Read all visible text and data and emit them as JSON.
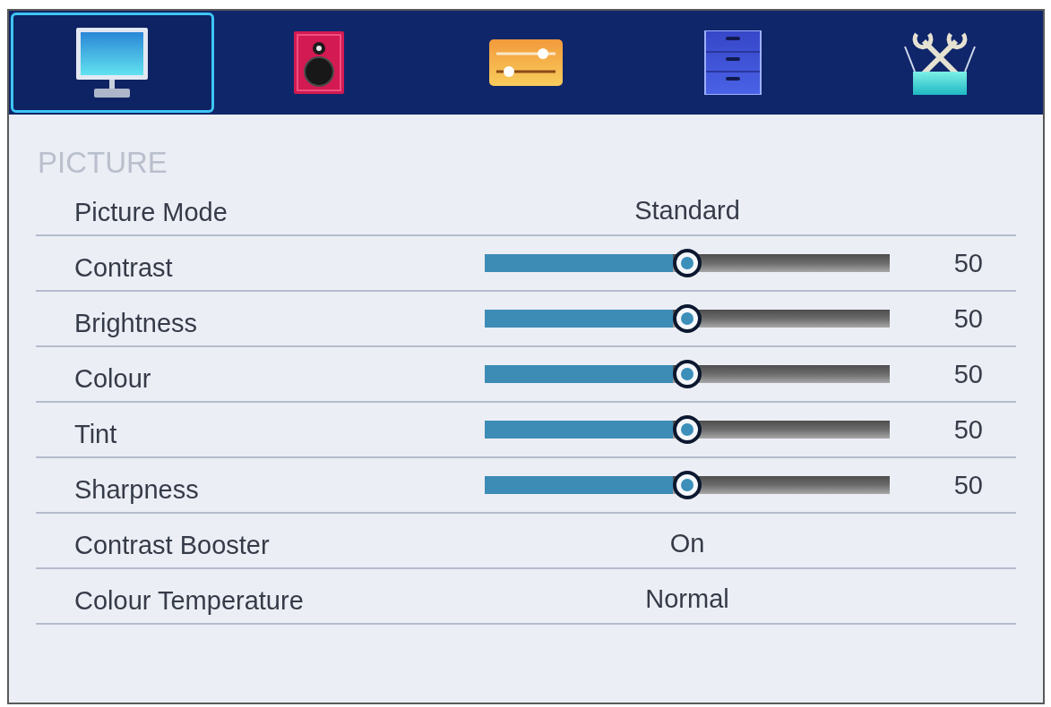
{
  "tabs": [
    {
      "kind": "monitor",
      "selected": true
    },
    {
      "kind": "speaker",
      "selected": false
    },
    {
      "kind": "sliders",
      "selected": false
    },
    {
      "kind": "drawers",
      "selected": false
    },
    {
      "kind": "tools",
      "selected": false
    }
  ],
  "section": {
    "title": "PICTURE",
    "rows": [
      {
        "kind": "option",
        "label": "Picture Mode",
        "value": "Standard"
      },
      {
        "kind": "slider",
        "label": "Contrast",
        "level": 0.5,
        "reading": "50"
      },
      {
        "kind": "slider",
        "label": "Brightness",
        "level": 0.5,
        "reading": "50"
      },
      {
        "kind": "slider",
        "label": "Colour",
        "level": 0.5,
        "reading": "50"
      },
      {
        "kind": "slider",
        "label": "Tint",
        "level": 0.5,
        "reading": "50"
      },
      {
        "kind": "slider",
        "label": "Sharpness",
        "level": 0.5,
        "reading": "50"
      },
      {
        "kind": "option",
        "label": "Contrast Booster",
        "value": "On"
      },
      {
        "kind": "option",
        "label": "Colour Temperature",
        "value": "Normal"
      }
    ]
  }
}
